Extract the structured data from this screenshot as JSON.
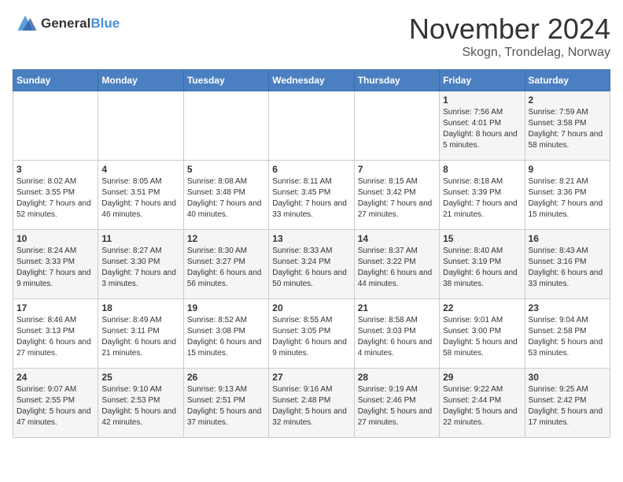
{
  "logo": {
    "general": "General",
    "blue": "Blue"
  },
  "title": "November 2024",
  "subtitle": "Skogn, Trondelag, Norway",
  "days_header": [
    "Sunday",
    "Monday",
    "Tuesday",
    "Wednesday",
    "Thursday",
    "Friday",
    "Saturday"
  ],
  "weeks": [
    [
      {
        "day": "",
        "content": ""
      },
      {
        "day": "",
        "content": ""
      },
      {
        "day": "",
        "content": ""
      },
      {
        "day": "",
        "content": ""
      },
      {
        "day": "",
        "content": ""
      },
      {
        "day": "1",
        "content": "Sunrise: 7:56 AM\nSunset: 4:01 PM\nDaylight: 8 hours and 5 minutes."
      },
      {
        "day": "2",
        "content": "Sunrise: 7:59 AM\nSunset: 3:58 PM\nDaylight: 7 hours and 58 minutes."
      }
    ],
    [
      {
        "day": "3",
        "content": "Sunrise: 8:02 AM\nSunset: 3:55 PM\nDaylight: 7 hours and 52 minutes."
      },
      {
        "day": "4",
        "content": "Sunrise: 8:05 AM\nSunset: 3:51 PM\nDaylight: 7 hours and 46 minutes."
      },
      {
        "day": "5",
        "content": "Sunrise: 8:08 AM\nSunset: 3:48 PM\nDaylight: 7 hours and 40 minutes."
      },
      {
        "day": "6",
        "content": "Sunrise: 8:11 AM\nSunset: 3:45 PM\nDaylight: 7 hours and 33 minutes."
      },
      {
        "day": "7",
        "content": "Sunrise: 8:15 AM\nSunset: 3:42 PM\nDaylight: 7 hours and 27 minutes."
      },
      {
        "day": "8",
        "content": "Sunrise: 8:18 AM\nSunset: 3:39 PM\nDaylight: 7 hours and 21 minutes."
      },
      {
        "day": "9",
        "content": "Sunrise: 8:21 AM\nSunset: 3:36 PM\nDaylight: 7 hours and 15 minutes."
      }
    ],
    [
      {
        "day": "10",
        "content": "Sunrise: 8:24 AM\nSunset: 3:33 PM\nDaylight: 7 hours and 9 minutes."
      },
      {
        "day": "11",
        "content": "Sunrise: 8:27 AM\nSunset: 3:30 PM\nDaylight: 7 hours and 3 minutes."
      },
      {
        "day": "12",
        "content": "Sunrise: 8:30 AM\nSunset: 3:27 PM\nDaylight: 6 hours and 56 minutes."
      },
      {
        "day": "13",
        "content": "Sunrise: 8:33 AM\nSunset: 3:24 PM\nDaylight: 6 hours and 50 minutes."
      },
      {
        "day": "14",
        "content": "Sunrise: 8:37 AM\nSunset: 3:22 PM\nDaylight: 6 hours and 44 minutes."
      },
      {
        "day": "15",
        "content": "Sunrise: 8:40 AM\nSunset: 3:19 PM\nDaylight: 6 hours and 38 minutes."
      },
      {
        "day": "16",
        "content": "Sunrise: 8:43 AM\nSunset: 3:16 PM\nDaylight: 6 hours and 33 minutes."
      }
    ],
    [
      {
        "day": "17",
        "content": "Sunrise: 8:46 AM\nSunset: 3:13 PM\nDaylight: 6 hours and 27 minutes."
      },
      {
        "day": "18",
        "content": "Sunrise: 8:49 AM\nSunset: 3:11 PM\nDaylight: 6 hours and 21 minutes."
      },
      {
        "day": "19",
        "content": "Sunrise: 8:52 AM\nSunset: 3:08 PM\nDaylight: 6 hours and 15 minutes."
      },
      {
        "day": "20",
        "content": "Sunrise: 8:55 AM\nSunset: 3:05 PM\nDaylight: 6 hours and 9 minutes."
      },
      {
        "day": "21",
        "content": "Sunrise: 8:58 AM\nSunset: 3:03 PM\nDaylight: 6 hours and 4 minutes."
      },
      {
        "day": "22",
        "content": "Sunrise: 9:01 AM\nSunset: 3:00 PM\nDaylight: 5 hours and 58 minutes."
      },
      {
        "day": "23",
        "content": "Sunrise: 9:04 AM\nSunset: 2:58 PM\nDaylight: 5 hours and 53 minutes."
      }
    ],
    [
      {
        "day": "24",
        "content": "Sunrise: 9:07 AM\nSunset: 2:55 PM\nDaylight: 5 hours and 47 minutes."
      },
      {
        "day": "25",
        "content": "Sunrise: 9:10 AM\nSunset: 2:53 PM\nDaylight: 5 hours and 42 minutes."
      },
      {
        "day": "26",
        "content": "Sunrise: 9:13 AM\nSunset: 2:51 PM\nDaylight: 5 hours and 37 minutes."
      },
      {
        "day": "27",
        "content": "Sunrise: 9:16 AM\nSunset: 2:48 PM\nDaylight: 5 hours and 32 minutes."
      },
      {
        "day": "28",
        "content": "Sunrise: 9:19 AM\nSunset: 2:46 PM\nDaylight: 5 hours and 27 minutes."
      },
      {
        "day": "29",
        "content": "Sunrise: 9:22 AM\nSunset: 2:44 PM\nDaylight: 5 hours and 22 minutes."
      },
      {
        "day": "30",
        "content": "Sunrise: 9:25 AM\nSunset: 2:42 PM\nDaylight: 5 hours and 17 minutes."
      }
    ]
  ]
}
